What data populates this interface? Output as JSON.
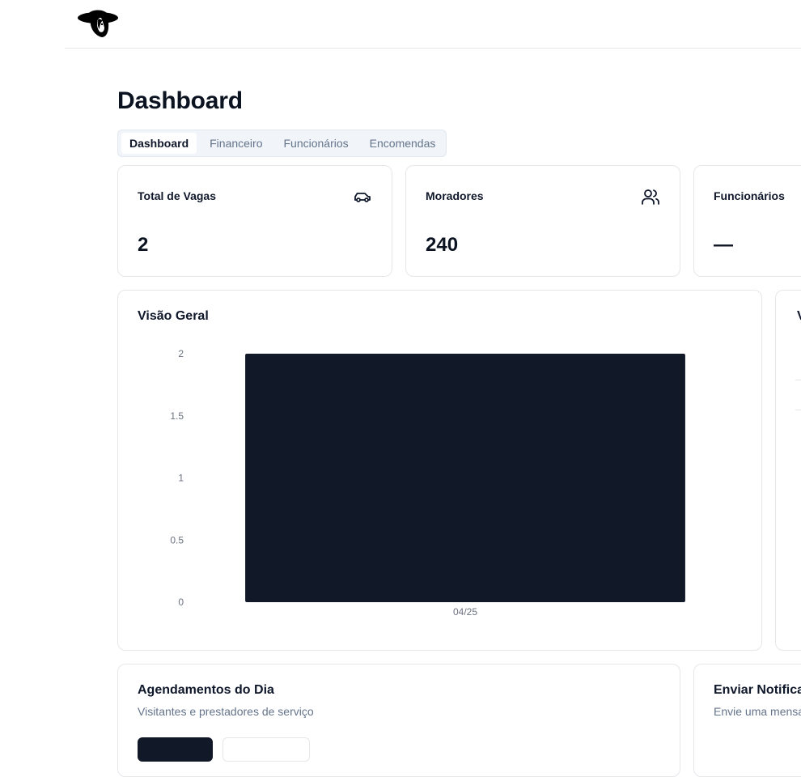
{
  "header": {
    "logo_icon": "hat-woman-logo-icon"
  },
  "page": {
    "title": "Dashboard"
  },
  "tabs": [
    {
      "label": "Dashboard",
      "active": true
    },
    {
      "label": "Financeiro",
      "active": false
    },
    {
      "label": "Funcionários",
      "active": false
    },
    {
      "label": "Encomendas",
      "active": false
    }
  ],
  "stats": [
    {
      "title": "Total de Vagas",
      "value": "2",
      "icon": "car-icon"
    },
    {
      "title": "Moradores",
      "value": "240",
      "icon": "users-icon"
    },
    {
      "title": "Funcionários",
      "value": "—",
      "icon": ""
    }
  ],
  "overview": {
    "title": "Visão Geral",
    "chart_data": {
      "type": "bar",
      "categories": [
        "04/25"
      ],
      "values": [
        2
      ],
      "ylim": [
        0,
        2
      ],
      "yticks": [
        "0",
        "0.5",
        "1",
        "1.5",
        "2"
      ],
      "bar_color": "#111827",
      "title": "",
      "xlabel": "",
      "ylabel": "",
      "grid": false
    }
  },
  "side_card": {
    "title": "V"
  },
  "appointments": {
    "title": "Agendamentos do Dia",
    "subtitle": "Visitantes e prestadores de serviço"
  },
  "notifications": {
    "title": "Enviar Notificac",
    "subtitle": "Envie uma mensa"
  }
}
